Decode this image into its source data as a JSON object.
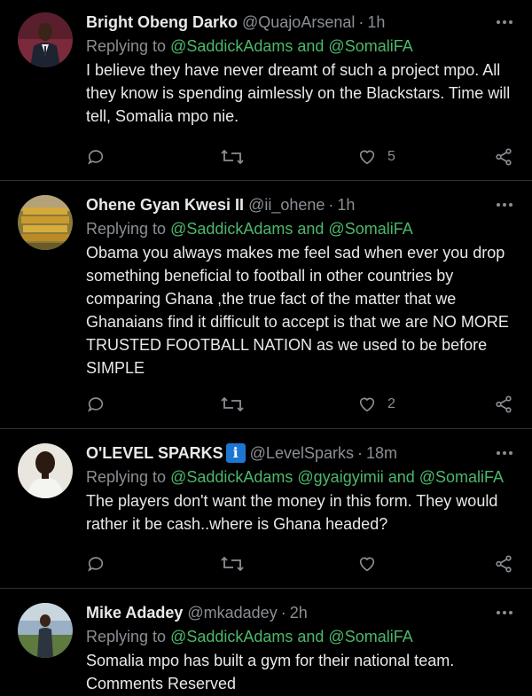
{
  "colors": {
    "background": "#000000",
    "text": "#e7e9ea",
    "muted": "#8b8f94",
    "mention": "#4cb86a",
    "divider": "#2f3336",
    "verified": "#1d76d2"
  },
  "icons": {
    "reply": "comment-bubble-icon",
    "retweet": "retweet-icon",
    "like": "heart-icon",
    "share": "share-icon",
    "more": "more-dots-icon"
  },
  "tweets": [
    {
      "name": "Bright Obeng Darko",
      "handle": "@QuajoArsenal",
      "time": "1h",
      "replying_prefix": "Replying to ",
      "mentions": "@SaddickAdams and @SomaliFA",
      "text": "I believe they have never dreamt of such a project mpo. All they know is spending aimlessly on the Blackstars. Time will tell, Somalia mpo nie.",
      "likes": "5"
    },
    {
      "name": "Ohene Gyan Kwesi II",
      "handle": "@ii_ohene",
      "time": "1h",
      "replying_prefix": "Replying to ",
      "mentions": "@SaddickAdams and @SomaliFA",
      "text": "Obama you always makes me feel sad when ever you drop something beneficial to football in other countries by comparing Ghana ,the true fact of the matter that we Ghanaians find it difficult to accept is that we are NO MORE TRUSTED FOOTBALL NATION as we used to be before SIMPLE",
      "likes": "2"
    },
    {
      "name": "O'LEVEL SPARKS",
      "badge": "i",
      "handle": "@LevelSparks",
      "time": "18m",
      "replying_prefix": "Replying to ",
      "mentions": "@SaddickAdams @gyaigyimii and @SomaliFA",
      "text": "The players don't want  the money in this form. They would rather it be cash..where is Ghana headed?",
      "likes": ""
    },
    {
      "name": "Mike Adadey",
      "handle": "@mkadadey",
      "time": "2h",
      "replying_prefix": "Replying to ",
      "mentions": "@SaddickAdams and @SomaliFA",
      "text": "Somalia mpo has built a gym for their national team. Comments Reserved",
      "likes": ""
    }
  ]
}
